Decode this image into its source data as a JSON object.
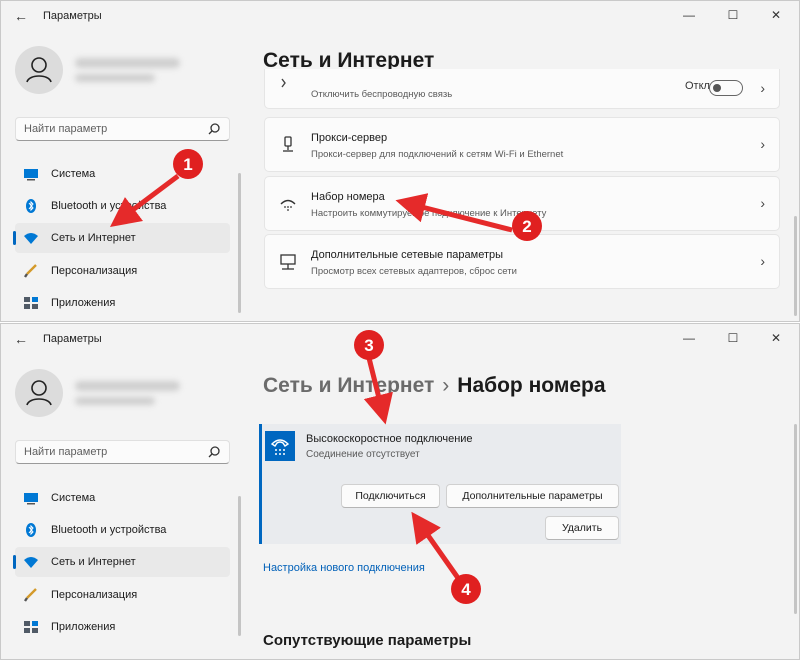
{
  "app_title": "Параметры",
  "window_controls": {
    "minimize": "—",
    "maximize": "☐",
    "close": "✕"
  },
  "back_glyph": "←",
  "search": {
    "placeholder": "Найти параметр"
  },
  "nav": [
    {
      "label": "Система",
      "icon": "monitor-icon"
    },
    {
      "label": "Bluetooth и устройства",
      "icon": "bluetooth-icon"
    },
    {
      "label": "Сеть и Интернет",
      "icon": "wifi-icon",
      "active": true
    },
    {
      "label": "Персонализация",
      "icon": "brush-icon"
    },
    {
      "label": "Приложения",
      "icon": "apps-icon"
    }
  ],
  "window1": {
    "heading": "Сеть и Интернет",
    "partial_card": {
      "subtitle": "Отключить беспроводную связь",
      "toggle_text": "Откл."
    },
    "cards": [
      {
        "title": "Прокси-сервер",
        "subtitle": "Прокси-сервер для подключений к сетям Wi-Fi и Ethernet",
        "icon": "proxy-icon"
      },
      {
        "title": "Набор номера",
        "subtitle": "Настроить коммутируемое подключение к Интернету",
        "icon": "dialup-icon"
      },
      {
        "title": "Дополнительные сетевые параметры",
        "subtitle": "Просмотр всех сетевых адаптеров, сброс сети",
        "icon": "network-adapter-icon"
      }
    ]
  },
  "window2": {
    "breadcrumb_parent": "Сеть и Интернет",
    "breadcrumb_sep": "›",
    "heading": "Набор номера",
    "connection": {
      "title": "Высокоскоростное подключение",
      "status": "Соединение отсутствует",
      "connect_label": "Подключиться",
      "advanced_label": "Дополнительные параметры",
      "delete_label": "Удалить"
    },
    "new_connection_link": "Настройка нового подключения",
    "related_heading": "Сопутствующие параметры"
  },
  "annotations": {
    "colors": {
      "badge": "#e02020",
      "arrow": "#e52a2a"
    },
    "badges": [
      "1",
      "2",
      "3",
      "4"
    ]
  }
}
